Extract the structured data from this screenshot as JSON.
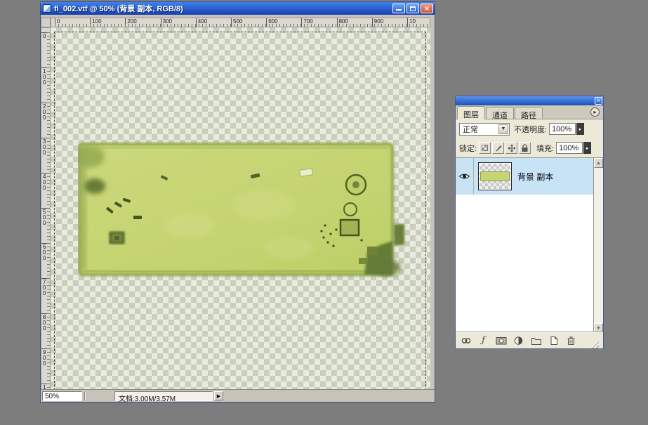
{
  "colors": {
    "desktop": "#7d7d7d",
    "titlebar_top": "#3f82ec",
    "titlebar_bottom": "#173fae",
    "close_button": "#d4502a",
    "panel_bg": "#ece9d8",
    "selected_layer_row": "#c8e2f6",
    "map_green": "#c6d572",
    "map_dark_green": "#5d742f",
    "checker_light": "#e8ebdf",
    "checker_dark": "#c9cfbb"
  },
  "doc_window": {
    "title": "fl_002.vtf @ 50% (背景 副本, RGB/8)",
    "ruler_h": [
      "0",
      "100",
      "200",
      "300",
      "400",
      "500",
      "600",
      "700",
      "800",
      "900",
      "10"
    ],
    "ruler_v": [
      "0",
      "100",
      "200",
      "300",
      "400",
      "500",
      "600",
      "700",
      "800",
      "900",
      "1"
    ],
    "zoom_status": "50%",
    "doc_info": "文档:3.00M/3.57M"
  },
  "layers_panel": {
    "tabs": [
      "图层",
      "通道",
      "路径"
    ],
    "blend_mode": "正常",
    "opacity_label": "不透明度:",
    "opacity_value": "100%",
    "lock_label": "锁定:",
    "fill_label": "填充:",
    "fill_value": "100%",
    "layer": {
      "name": "背景 副本"
    },
    "footer_icons": [
      "link-icon",
      "layer-style-icon",
      "layer-mask-icon",
      "adjustment-layer-icon",
      "layer-group-icon",
      "new-layer-icon",
      "delete-layer-icon"
    ],
    "lock_icons": [
      "lock-transparency-icon",
      "lock-image-icon",
      "lock-position-icon",
      "lock-all-icon"
    ]
  }
}
